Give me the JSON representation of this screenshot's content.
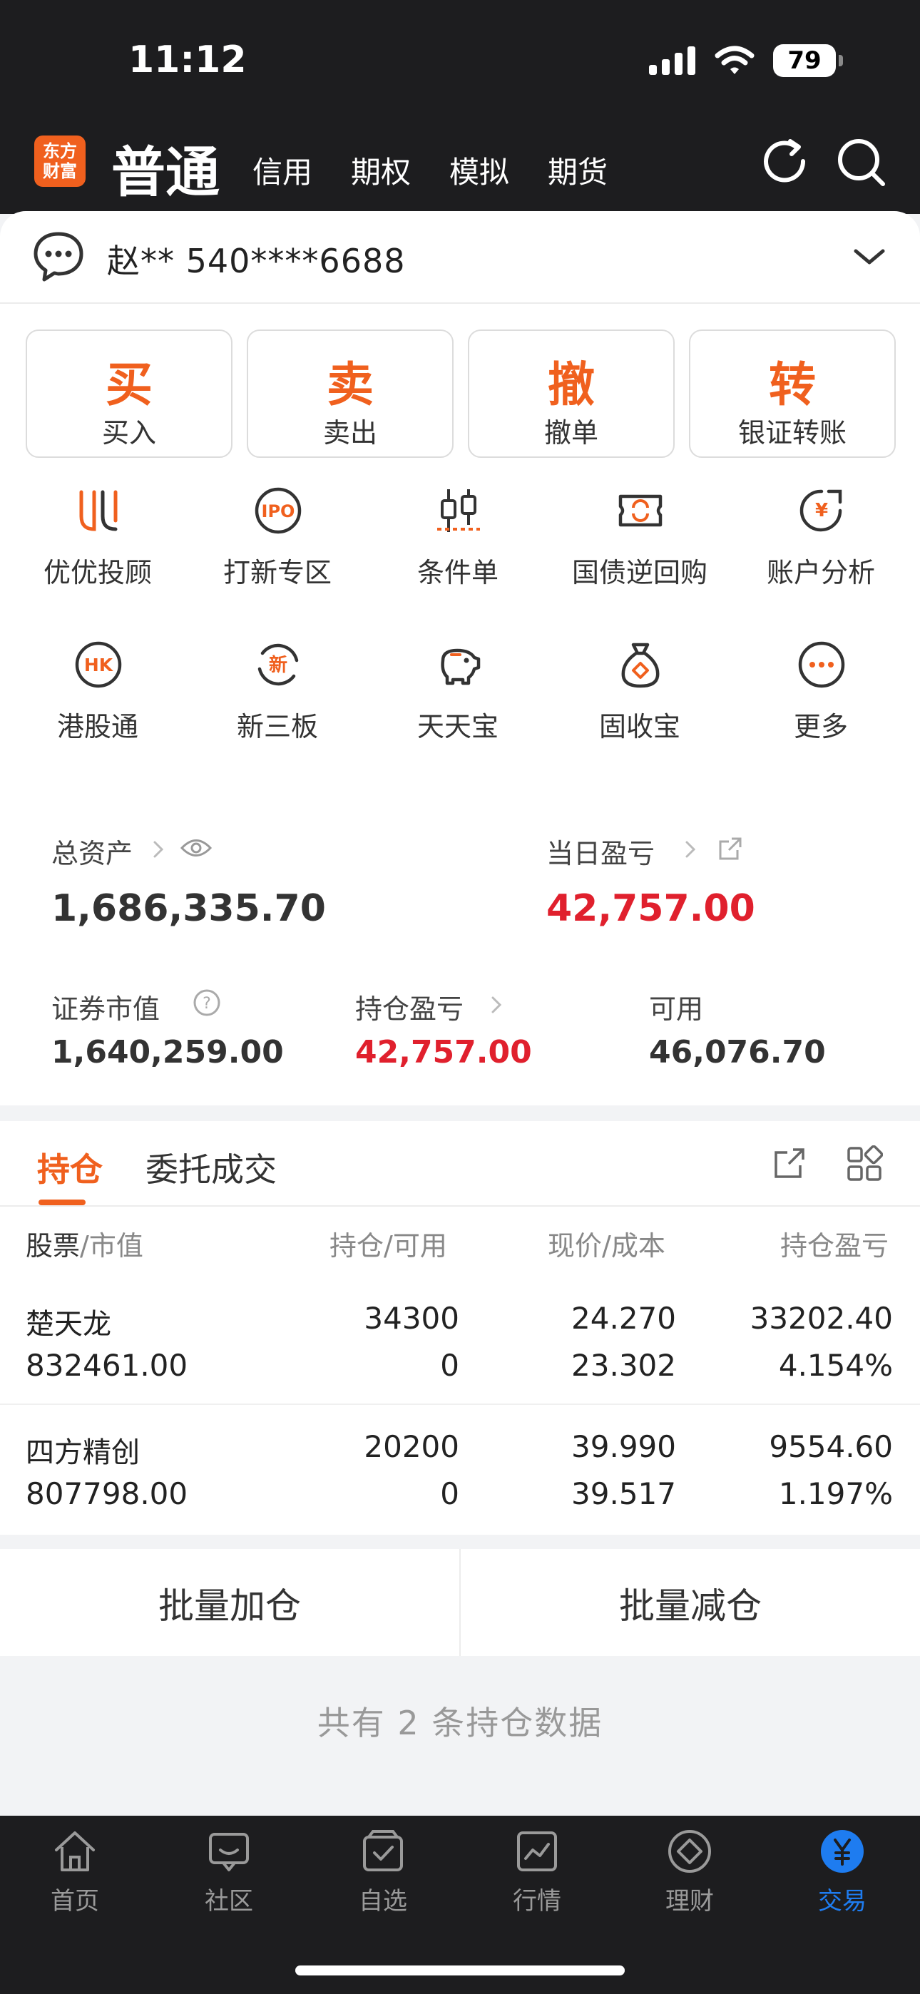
{
  "status": {
    "time": "11:12",
    "battery": "79"
  },
  "header": {
    "logo_text": "东方财富",
    "main_tab": "普通",
    "tabs": [
      "信用",
      "期权",
      "模拟",
      "期货"
    ]
  },
  "account": {
    "text": "赵** 540****6688"
  },
  "actions": [
    {
      "char": "买",
      "label": "买入"
    },
    {
      "char": "卖",
      "label": "卖出"
    },
    {
      "char": "撤",
      "label": "撤单"
    },
    {
      "char": "转",
      "label": "银证转账"
    }
  ],
  "grid": [
    {
      "icon": "uu-advisor-icon",
      "label": "优优投顾"
    },
    {
      "icon": "ipo-icon",
      "label": "打新专区",
      "icon_text": "IPO"
    },
    {
      "icon": "candlestick-icon",
      "label": "条件单"
    },
    {
      "icon": "repo-ticket-icon",
      "label": "国债逆回购"
    },
    {
      "icon": "account-analysis-icon",
      "label": "账户分析"
    },
    {
      "icon": "hk-connect-icon",
      "label": "港股通",
      "icon_text": "HK"
    },
    {
      "icon": "new-third-board-icon",
      "label": "新三板",
      "icon_text": "新"
    },
    {
      "icon": "piggy-bank-icon",
      "label": "天天宝"
    },
    {
      "icon": "money-bag-icon",
      "label": "固收宝"
    },
    {
      "icon": "more-icon",
      "label": "更多"
    }
  ],
  "assets": {
    "total_label": "总资产",
    "total_value": "1,686,335.70",
    "daily_label": "当日盈亏",
    "daily_value": "42,757.00",
    "market_label": "证券市值",
    "market_value": "1,640,259.00",
    "hold_pl_label": "持仓盈亏",
    "hold_pl_value": "42,757.00",
    "available_label": "可用",
    "available_value": "46,076.70"
  },
  "positions": {
    "tab_active": "持仓",
    "tab_other": "委托成交",
    "headers": {
      "stock": "股票",
      "stock_sub": "/市值",
      "qty": "持仓",
      "qty_sub": "/可用",
      "price": "现价",
      "price_sub": "/成本",
      "pl": "持仓盈亏"
    },
    "rows": [
      {
        "name": "楚天龙",
        "market_value": "832461.00",
        "qty": "34300",
        "available": "0",
        "price": "24.270",
        "cost": "23.302",
        "pl": "33202.40",
        "pl_pct": "4.154%"
      },
      {
        "name": "四方精创",
        "market_value": "807798.00",
        "qty": "20200",
        "available": "0",
        "price": "39.990",
        "cost": "39.517",
        "pl": "9554.60",
        "pl_pct": "1.197%"
      }
    ],
    "batch_add": "批量加仓",
    "batch_reduce": "批量减仓",
    "summary": "共有 2 条持仓数据"
  },
  "tabbar": [
    {
      "icon": "home-icon",
      "label": "首页"
    },
    {
      "icon": "community-icon",
      "label": "社区"
    },
    {
      "icon": "watchlist-icon",
      "label": "自选"
    },
    {
      "icon": "market-icon",
      "label": "行情"
    },
    {
      "icon": "wealth-icon",
      "label": "理财"
    },
    {
      "icon": "trade-icon",
      "label": "交易",
      "active": true
    }
  ],
  "colors": {
    "accent": "#f0601e",
    "profit": "#e0202d",
    "active_tab": "#1e7cf0",
    "header_bg": "#1d1d1f"
  }
}
